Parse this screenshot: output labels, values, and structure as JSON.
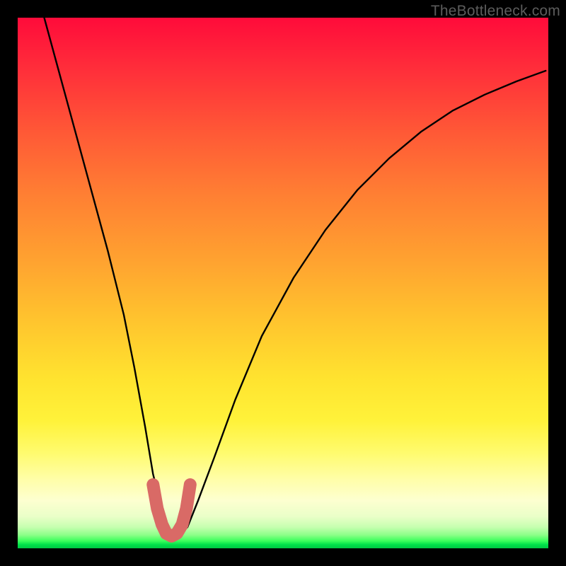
{
  "watermark": "TheBottleneck.com",
  "chart_data": {
    "type": "line",
    "title": "",
    "xlabel": "",
    "ylabel": "",
    "xlim": [
      0,
      100
    ],
    "ylim": [
      0,
      100
    ],
    "grid": false,
    "series": [
      {
        "name": "bottleneck-curve",
        "x": [
          5,
          8,
          11,
          14,
          17,
          20,
          22,
          24,
          25.5,
          27,
          28,
          29,
          30.5,
          32,
          34,
          37,
          41,
          46,
          52,
          58,
          64,
          70,
          76,
          82,
          88,
          94,
          99.5
        ],
        "y": [
          100,
          89,
          78,
          67,
          56,
          44,
          34,
          23,
          14,
          8,
          4,
          2.5,
          2.5,
          4,
          9,
          17,
          28,
          40,
          51,
          60,
          67.5,
          73.5,
          78.5,
          82.5,
          85.5,
          88,
          90
        ]
      },
      {
        "name": "highlight-u",
        "x": [
          25.5,
          26.3,
          27.2,
          28,
          29,
          30,
          31,
          31.8,
          32.5
        ],
        "y": [
          12,
          7.5,
          4.5,
          2.8,
          2.3,
          2.8,
          4.5,
          7.5,
          12
        ]
      }
    ],
    "colors": {
      "curve": "#000000",
      "highlight": "#d96a66"
    }
  }
}
